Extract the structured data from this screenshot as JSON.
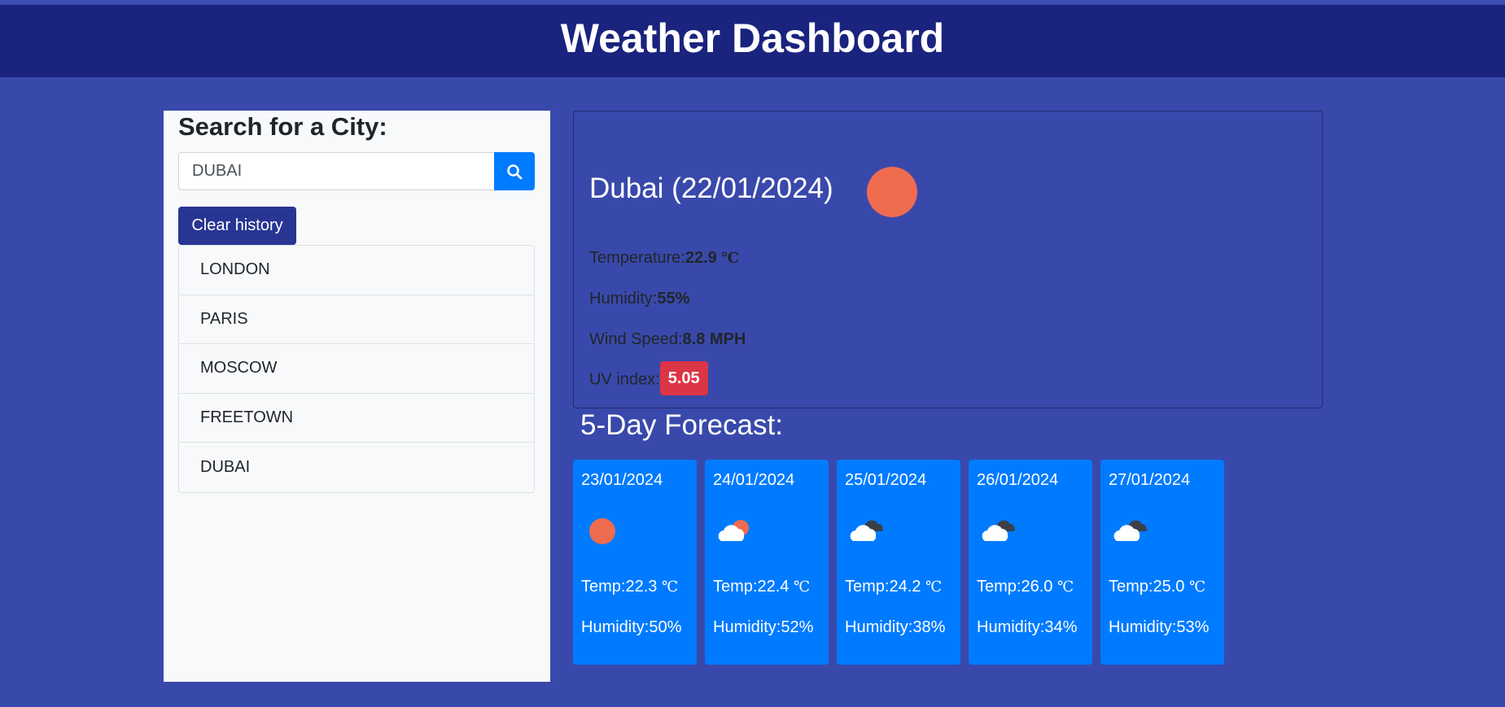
{
  "header": {
    "title": "Weather Dashboard"
  },
  "search": {
    "title": "Search for a City:",
    "value": "DUBAI",
    "placeholder": "",
    "clear_label": "Clear history"
  },
  "history": [
    "LONDON",
    "PARIS",
    "MOSCOW",
    "FREETOWN",
    "DUBAI"
  ],
  "current": {
    "title": "Dubai (22/01/2024)",
    "icon": "sun-icon",
    "temp_label": "Temperature:",
    "temp_value": "22.9",
    "temp_unit": "℃",
    "humidity_label": "Humidity:",
    "humidity_value": "55%",
    "wind_label": "Wind Speed:",
    "wind_value": "8.8 MPH",
    "uv_label": "UV index:",
    "uv_value": "5.05"
  },
  "forecast": {
    "title": "5-Day Forecast:",
    "days": [
      {
        "date": "23/01/2024",
        "icon": "sun-icon",
        "temp": "Temp:22.3",
        "unit": "℃",
        "humidity": "Humidity:50%"
      },
      {
        "date": "24/01/2024",
        "icon": "sun-cloud-icon",
        "temp": "Temp:22.4",
        "unit": "℃",
        "humidity": "Humidity:52%"
      },
      {
        "date": "25/01/2024",
        "icon": "clouds-icon",
        "temp": "Temp:24.2",
        "unit": "℃",
        "humidity": "Humidity:38%"
      },
      {
        "date": "26/01/2024",
        "icon": "clouds-icon",
        "temp": "Temp:26.0",
        "unit": "℃",
        "humidity": "Humidity:34%"
      },
      {
        "date": "27/01/2024",
        "icon": "clouds-icon",
        "temp": "Temp:25.0",
        "unit": "℃",
        "humidity": "Humidity:53%"
      }
    ]
  },
  "colors": {
    "background": "#3949ab",
    "header": "#1a237e",
    "accent": "#007bff",
    "clear_button": "#283593",
    "uv_badge": "#dc3545",
    "sun": "#ef6c4f"
  }
}
